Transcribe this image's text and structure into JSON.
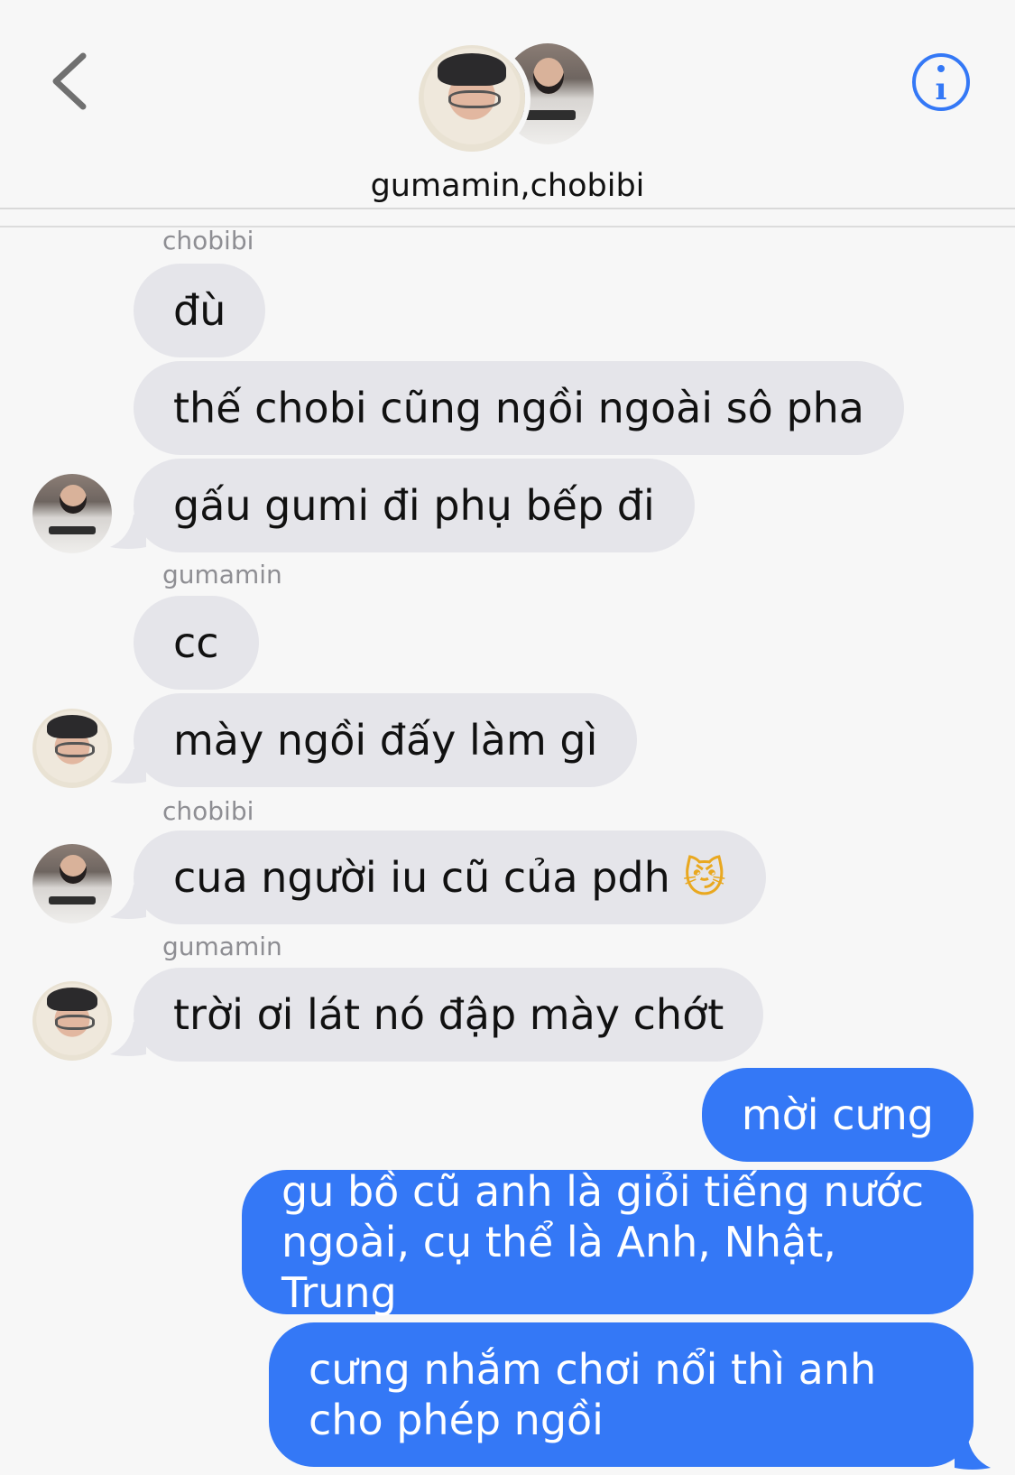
{
  "header": {
    "title": "gumamin,chobibi",
    "back_icon": "chevron-left-icon",
    "info_icon": "info-icon",
    "accent_color": "#3478f6"
  },
  "messages": [
    {
      "sender_label": "chobibi",
      "text": "đù",
      "direction": "in"
    },
    {
      "text": "thế chobi cũng ngồi ngoài sô pha",
      "direction": "in"
    },
    {
      "text": "gấu gumi đi phụ bếp đi",
      "direction": "in"
    },
    {
      "sender_label": "gumamin",
      "text": "cc",
      "direction": "in"
    },
    {
      "text": "mày ngồi đấy làm gì",
      "direction": "in"
    },
    {
      "sender_label": "chobibi",
      "text": "cua người iu cũ của pdh",
      "emoji": "😼",
      "direction": "in"
    },
    {
      "sender_label": "gumamin",
      "text": "trời ơi lát nó đập mày chớt",
      "direction": "in"
    },
    {
      "text": "mời cưng",
      "direction": "out"
    },
    {
      "text": "gu bồ cũ anh là giỏi tiếng nước ngoài, cụ thể là Anh, Nhật, Trung",
      "direction": "out"
    },
    {
      "text": "cưng nhắm chơi nổi thì anh cho phép ngồi",
      "direction": "out"
    }
  ],
  "colors": {
    "incoming_bubble": "#e5e5ea",
    "outgoing_bubble": "#3478f6",
    "background": "#f7f7f7",
    "sender_label": "#8e8e93"
  }
}
